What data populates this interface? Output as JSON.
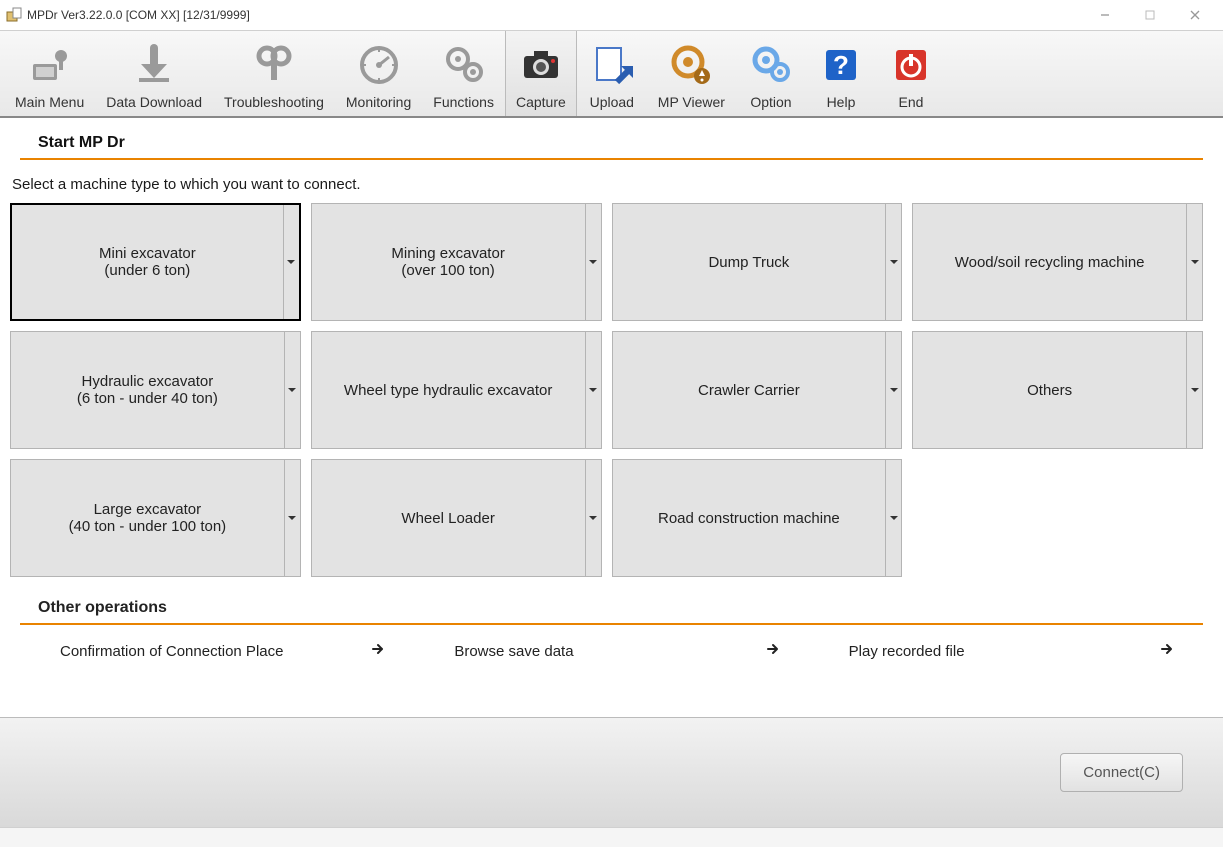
{
  "window": {
    "title": "MPDr Ver3.22.0.0 [COM XX] [12/31/9999]"
  },
  "toolbar": [
    {
      "id": "main-menu",
      "label": "Main Menu",
      "active": false
    },
    {
      "id": "data-download",
      "label": "Data Download",
      "active": false
    },
    {
      "id": "troubleshoot",
      "label": "Troubleshooting",
      "active": false
    },
    {
      "id": "monitoring",
      "label": "Monitoring",
      "active": false
    },
    {
      "id": "functions",
      "label": "Functions",
      "active": false
    },
    {
      "id": "capture",
      "label": "Capture",
      "active": true
    },
    {
      "id": "upload",
      "label": "Upload",
      "active": false
    },
    {
      "id": "mp-viewer",
      "label": "MP Viewer",
      "active": false
    },
    {
      "id": "option",
      "label": "Option",
      "active": false
    },
    {
      "id": "help",
      "label": "Help",
      "active": false
    },
    {
      "id": "end",
      "label": "End",
      "active": false
    }
  ],
  "main": {
    "start_title": "Start MP Dr",
    "instruction": "Select a machine type to which you want to connect.",
    "machines": [
      {
        "line1": "Mini excavator",
        "line2": "(under 6 ton)",
        "selected": true
      },
      {
        "line1": "Mining excavator",
        "line2": "(over 100 ton)",
        "selected": false
      },
      {
        "line1": "Dump Truck",
        "line2": "",
        "selected": false
      },
      {
        "line1": "Wood/soil recycling machine",
        "line2": "",
        "selected": false
      },
      {
        "line1": "Hydraulic excavator",
        "line2": "(6 ton - under 40 ton)",
        "selected": false
      },
      {
        "line1": "Wheel type hydraulic excavator",
        "line2": "",
        "selected": false
      },
      {
        "line1": "Crawler Carrier",
        "line2": "",
        "selected": false
      },
      {
        "line1": "Others",
        "line2": "",
        "selected": false
      },
      {
        "line1": "Large excavator",
        "line2": "(40 ton - under 100 ton)",
        "selected": false
      },
      {
        "line1": "Wheel Loader",
        "line2": "",
        "selected": false
      },
      {
        "line1": "Road construction machine",
        "line2": "",
        "selected": false
      }
    ],
    "other_title": "Other operations",
    "other_ops": [
      {
        "label": "Confirmation of Connection Place"
      },
      {
        "label": "Browse save data"
      },
      {
        "label": "Play recorded file"
      }
    ]
  },
  "footer": {
    "connect_label": "Connect(C)"
  }
}
